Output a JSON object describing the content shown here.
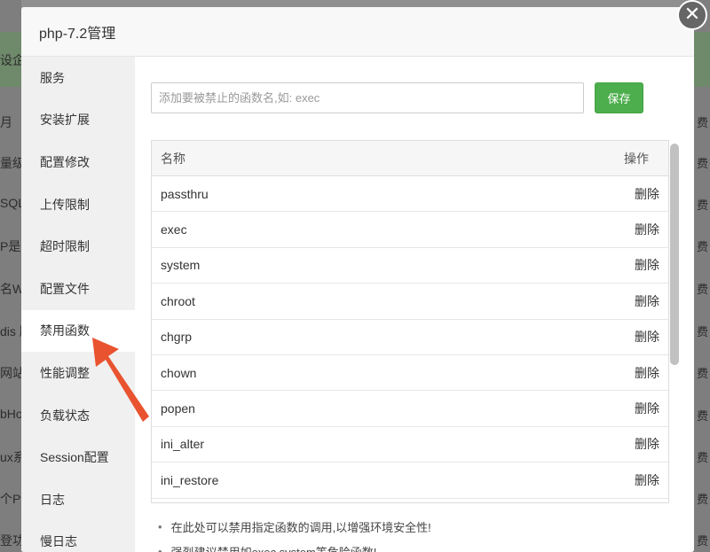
{
  "background": {
    "left_snippets": [
      "设企业",
      "月",
      "量级",
      "SQL",
      "P是",
      "名Wo",
      "dis 服",
      "网站",
      "bHo",
      "ux系",
      "个Py",
      "登功"
    ],
    "right_snippets": [
      "费",
      "费",
      "费",
      "费",
      "费",
      "费",
      "费",
      "费",
      "费",
      "费",
      "费",
      "费"
    ]
  },
  "dialog": {
    "title": "php-7.2管理",
    "close_glyph": "✕"
  },
  "sidebar": {
    "items": [
      {
        "label": "服务"
      },
      {
        "label": "安装扩展"
      },
      {
        "label": "配置修改"
      },
      {
        "label": "上传限制"
      },
      {
        "label": "超时限制"
      },
      {
        "label": "配置文件"
      },
      {
        "label": "禁用函数",
        "active": true
      },
      {
        "label": "性能调整"
      },
      {
        "label": "负载状态"
      },
      {
        "label": "Session配置"
      },
      {
        "label": "日志"
      },
      {
        "label": "慢日志"
      }
    ]
  },
  "form": {
    "placeholder": "添加要被禁止的函数名,如: exec",
    "value": "",
    "save_label": "保存"
  },
  "table": {
    "headers": {
      "name": "名称",
      "action": "操作"
    },
    "rows": [
      {
        "name": "passthru",
        "action": "删除"
      },
      {
        "name": "exec",
        "action": "删除"
      },
      {
        "name": "system",
        "action": "删除"
      },
      {
        "name": "chroot",
        "action": "删除"
      },
      {
        "name": "chgrp",
        "action": "删除"
      },
      {
        "name": "chown",
        "action": "删除"
      },
      {
        "name": "popen",
        "action": "删除"
      },
      {
        "name": "ini_alter",
        "action": "删除"
      },
      {
        "name": "ini_restore",
        "action": "删除"
      }
    ]
  },
  "tips": [
    "在此处可以禁用指定函数的调用,以增强环境安全性!",
    "强烈建议禁用如exec,system等危险函数!"
  ],
  "colors": {
    "accent_green": "#4cae4c",
    "annotation_arrow": "#e9532f"
  }
}
